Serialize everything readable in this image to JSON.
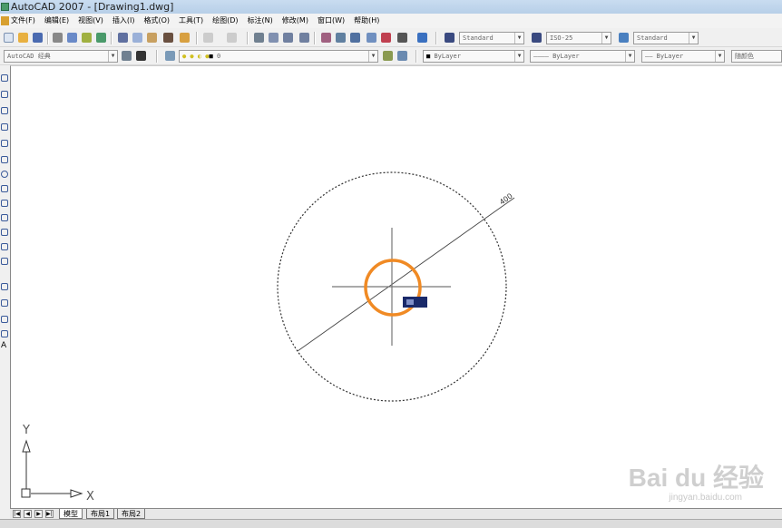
{
  "window": {
    "title": "AutoCAD 2007 - [Drawing1.dwg]"
  },
  "menu": [
    "文件(F)",
    "编辑(E)",
    "视图(V)",
    "插入(I)",
    "格式(O)",
    "工具(T)",
    "绘图(D)",
    "标注(N)",
    "修改(M)",
    "窗口(W)",
    "帮助(H)"
  ],
  "styles": {
    "text_style": "Standard",
    "dim_style": "ISO-25",
    "table_style": "Standard"
  },
  "workspace": "AutoCAD 经典",
  "layer": "0",
  "properties": {
    "color": "ByLayer",
    "linetype": "ByLayer",
    "lineweight": "ByLayer",
    "plotstyle": "随颜色"
  },
  "drawing": {
    "dimension_text": "400",
    "accent": "#f08a24",
    "tooltip_color": "#1a2a6a"
  },
  "ucs": {
    "x_label": "X",
    "y_label": "Y"
  },
  "layout_tabs": [
    "模型",
    "布局1",
    "布局2"
  ],
  "watermark": {
    "brand": "Bai du 经验",
    "url": "jingyan.baidu.com"
  }
}
